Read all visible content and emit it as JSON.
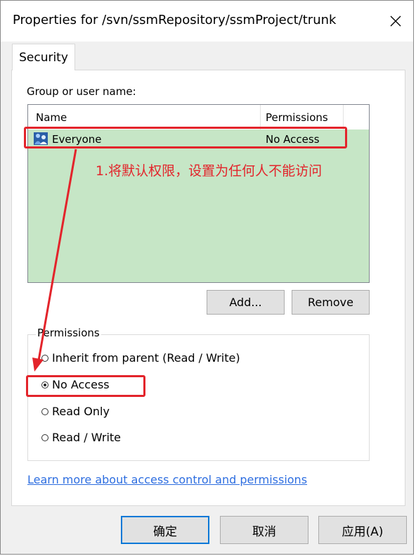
{
  "window": {
    "title": "Properties for /svn/ssmRepository/ssmProject/trunk"
  },
  "tabs": [
    {
      "label": "Security"
    }
  ],
  "security": {
    "group_label": "Group or user name:",
    "columns": {
      "name": "Name",
      "permissions": "Permissions"
    },
    "rows": [
      {
        "name": "Everyone",
        "permission": "No Access",
        "icon": "user-group-icon"
      }
    ],
    "add_button": "Add...",
    "remove_button": "Remove",
    "permissions_group": "Permissions",
    "options": [
      {
        "label": "Inherit from parent (Read / Write)",
        "checked": false
      },
      {
        "label": "No Access",
        "checked": true
      },
      {
        "label": "Read Only",
        "checked": false
      },
      {
        "label": "Read / Write",
        "checked": false
      }
    ],
    "help_link": "Learn more about access control and permissions"
  },
  "annotation": {
    "text": "1.将默认权限，设置为任何人不能访问",
    "color": "#e3242b"
  },
  "footer": {
    "ok": "确定",
    "cancel": "取消",
    "apply": "应用(A)"
  },
  "colors": {
    "list_background": "#c6e6c6",
    "link": "#2e6ee0",
    "accent_border": "#0078d7"
  }
}
